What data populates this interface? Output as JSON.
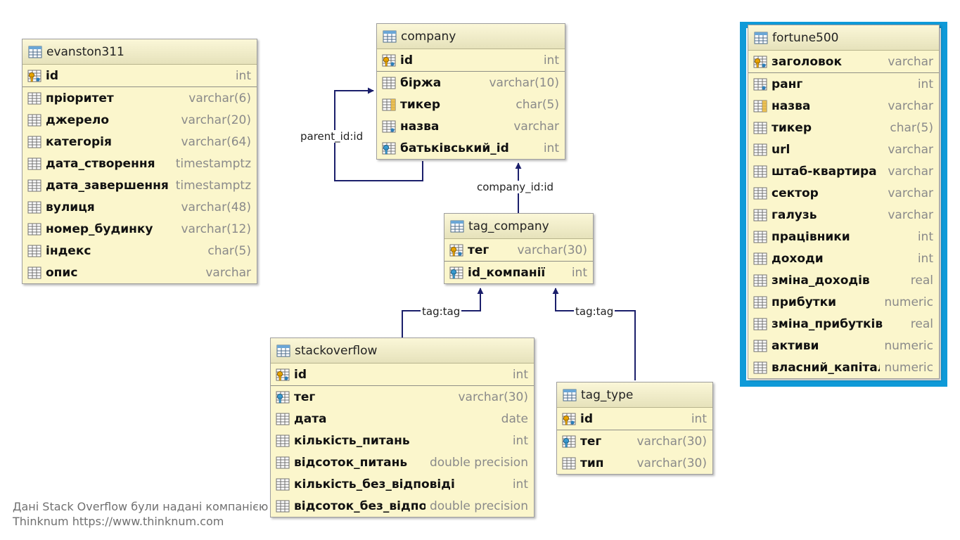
{
  "tables": [
    {
      "id": "evanston311",
      "name": "evanston311",
      "columns": [
        {
          "name": "id",
          "type": "int",
          "icon": "primary-key-icon"
        },
        {
          "name": "пріоритет",
          "type": "varchar(6)",
          "icon": "column-icon"
        },
        {
          "name": "джерело",
          "type": "varchar(20)",
          "icon": "column-icon"
        },
        {
          "name": "категорія",
          "type": "varchar(64)",
          "icon": "column-icon"
        },
        {
          "name": "дата_створення",
          "type": "timestamptz",
          "icon": "column-icon"
        },
        {
          "name": "дата_завершення",
          "type": "timestamptz",
          "icon": "column-icon"
        },
        {
          "name": "вулиця",
          "type": "varchar(48)",
          "icon": "column-icon"
        },
        {
          "name": "номер_будинку",
          "type": "varchar(12)",
          "icon": "column-icon"
        },
        {
          "name": "індекс",
          "type": "char(5)",
          "icon": "column-icon"
        },
        {
          "name": "опис",
          "type": "varchar",
          "icon": "column-icon"
        }
      ]
    },
    {
      "id": "company",
      "name": "company",
      "columns": [
        {
          "name": "id",
          "type": "int",
          "icon": "primary-key-icon"
        },
        {
          "name": "біржа",
          "type": "varchar(10)",
          "icon": "column-icon"
        },
        {
          "name": "тикер",
          "type": "char(5)",
          "icon": "unique-column-icon"
        },
        {
          "name": "назва",
          "type": "varchar",
          "icon": "not-null-column-icon"
        },
        {
          "name": "батьківський_id",
          "type": "int",
          "icon": "foreign-key-icon"
        }
      ]
    },
    {
      "id": "tag_company",
      "name": "tag_company",
      "columns": [
        {
          "name": "тег",
          "type": "varchar(30)",
          "icon": "primary-key-icon"
        },
        {
          "name": "id_компанії",
          "type": "int",
          "icon": "foreign-key-icon"
        }
      ]
    },
    {
      "id": "stackoverflow",
      "name": "stackoverflow",
      "columns": [
        {
          "name": "id",
          "type": "int",
          "icon": "primary-key-icon"
        },
        {
          "name": "тег",
          "type": "varchar(30)",
          "icon": "foreign-key-icon"
        },
        {
          "name": "дата",
          "type": "date",
          "icon": "column-icon"
        },
        {
          "name": "кількість_питань",
          "type": "int",
          "icon": "column-icon"
        },
        {
          "name": "відсоток_питань",
          "type": "double precision",
          "icon": "column-icon"
        },
        {
          "name": "кількість_без_відповіді",
          "type": "int",
          "icon": "column-icon"
        },
        {
          "name": "відсоток_без_відповіді",
          "type": "double precision",
          "icon": "column-icon"
        }
      ]
    },
    {
      "id": "tag_type",
      "name": "tag_type",
      "columns": [
        {
          "name": "id",
          "type": "int",
          "icon": "primary-key-icon"
        },
        {
          "name": "тег",
          "type": "varchar(30)",
          "icon": "foreign-key-icon"
        },
        {
          "name": "тип",
          "type": "varchar(30)",
          "icon": "column-icon"
        }
      ]
    },
    {
      "id": "fortune500",
      "name": "fortune500",
      "highlighted": true,
      "columns": [
        {
          "name": "заголовок",
          "type": "varchar",
          "icon": "primary-key-icon"
        },
        {
          "name": "ранг",
          "type": "int",
          "icon": "not-null-column-icon"
        },
        {
          "name": "назва",
          "type": "varchar",
          "icon": "unique-column-icon"
        },
        {
          "name": "тикер",
          "type": "char(5)",
          "icon": "column-icon"
        },
        {
          "name": "url",
          "type": "varchar",
          "icon": "column-icon"
        },
        {
          "name": "штаб-квартира",
          "type": "varchar",
          "icon": "column-icon"
        },
        {
          "name": "сектор",
          "type": "varchar",
          "icon": "column-icon"
        },
        {
          "name": "галузь",
          "type": "varchar",
          "icon": "column-icon"
        },
        {
          "name": "працівники",
          "type": "int",
          "icon": "column-icon"
        },
        {
          "name": "доходи",
          "type": "int",
          "icon": "column-icon"
        },
        {
          "name": "зміна_доходів",
          "type": "real",
          "icon": "column-icon"
        },
        {
          "name": "прибутки",
          "type": "numeric",
          "icon": "column-icon"
        },
        {
          "name": "зміна_прибутків",
          "type": "real",
          "icon": "column-icon"
        },
        {
          "name": "активи",
          "type": "numeric",
          "icon": "column-icon"
        },
        {
          "name": "власний_капітал",
          "type": "numeric",
          "icon": "column-icon"
        }
      ]
    }
  ],
  "relationships": [
    {
      "id": "company-self",
      "label": "parent_id:id"
    },
    {
      "id": "tagcompany-company",
      "label": "company_id:id"
    },
    {
      "id": "stackoverflow-tagcompany",
      "label": "tag:tag"
    },
    {
      "id": "tagtype-tagcompany",
      "label": "tag:tag"
    }
  ],
  "colors": {
    "table_bg": "#fbf6cc",
    "highlight": "#0f9ad8",
    "relationship_line": "#1b1f6b"
  },
  "footnote": {
    "line1": "Дані Stack Overflow були надані компанією",
    "line2": "Thinknum https://www.thinknum.com"
  }
}
